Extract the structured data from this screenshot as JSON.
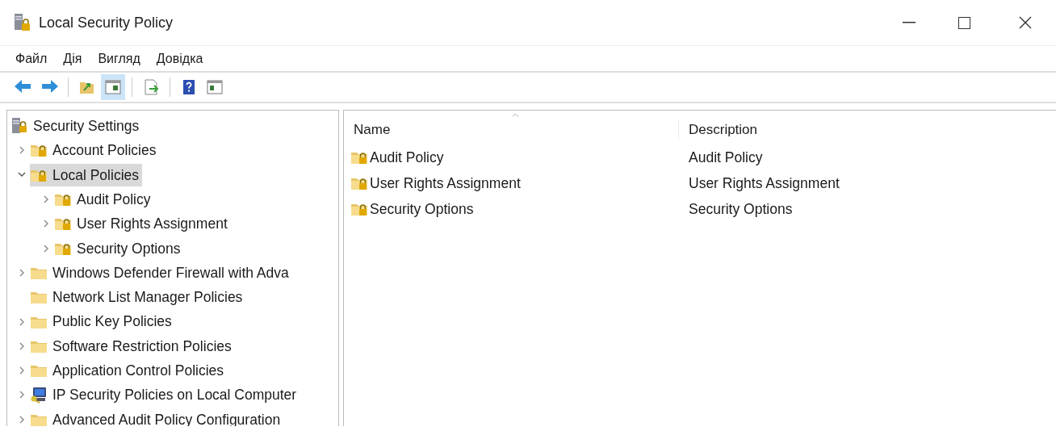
{
  "window": {
    "title": "Local Security Policy"
  },
  "menu": [
    "Файл",
    "Дія",
    "Вигляд",
    "Довідка"
  ],
  "toolbar": [
    {
      "kind": "back",
      "pressed": false
    },
    {
      "kind": "forward",
      "pressed": false
    },
    {
      "kind": "sep"
    },
    {
      "kind": "up",
      "pressed": false
    },
    {
      "kind": "tree",
      "pressed": true
    },
    {
      "kind": "sep"
    },
    {
      "kind": "export",
      "pressed": false
    },
    {
      "kind": "sep"
    },
    {
      "kind": "help",
      "pressed": false
    },
    {
      "kind": "action",
      "pressed": false
    }
  ],
  "tree": [
    {
      "label": "Security Settings",
      "kind": "server",
      "selected": false,
      "children": [
        {
          "label": "Account Policies",
          "kind": "locked-folder",
          "expanded": false,
          "selected": false
        },
        {
          "label": "Local Policies",
          "kind": "locked-folder",
          "expanded": true,
          "selected": true,
          "children": [
            {
              "label": "Audit Policy",
              "kind": "locked-folder",
              "expanded": false,
              "selected": false
            },
            {
              "label": "User Rights Assignment",
              "kind": "locked-folder",
              "expanded": false,
              "selected": false
            },
            {
              "label": "Security Options",
              "kind": "locked-folder",
              "expanded": false,
              "selected": false
            }
          ]
        },
        {
          "label": "Windows Defender Firewall with Adva",
          "kind": "folder",
          "expanded": false,
          "selected": false
        },
        {
          "label": "Network List Manager Policies",
          "kind": "folder",
          "selected": false
        },
        {
          "label": "Public Key Policies",
          "kind": "folder",
          "expanded": false,
          "selected": false
        },
        {
          "label": "Software Restriction Policies",
          "kind": "folder",
          "expanded": false,
          "selected": false
        },
        {
          "label": "Application Control Policies",
          "kind": "folder",
          "expanded": false,
          "selected": false
        },
        {
          "label": "IP Security Policies on Local Computer",
          "kind": "computer",
          "expanded": false,
          "selected": false
        },
        {
          "label": "Advanced Audit Policy Configuration",
          "kind": "folder",
          "expanded": false,
          "selected": false
        }
      ]
    }
  ],
  "list": {
    "columns": [
      "Name",
      "Description"
    ],
    "rows": [
      [
        "Audit Policy",
        "Audit Policy"
      ],
      [
        "User Rights Assignment",
        "User Rights Assignment"
      ],
      [
        "Security Options",
        "Security Options"
      ]
    ]
  }
}
